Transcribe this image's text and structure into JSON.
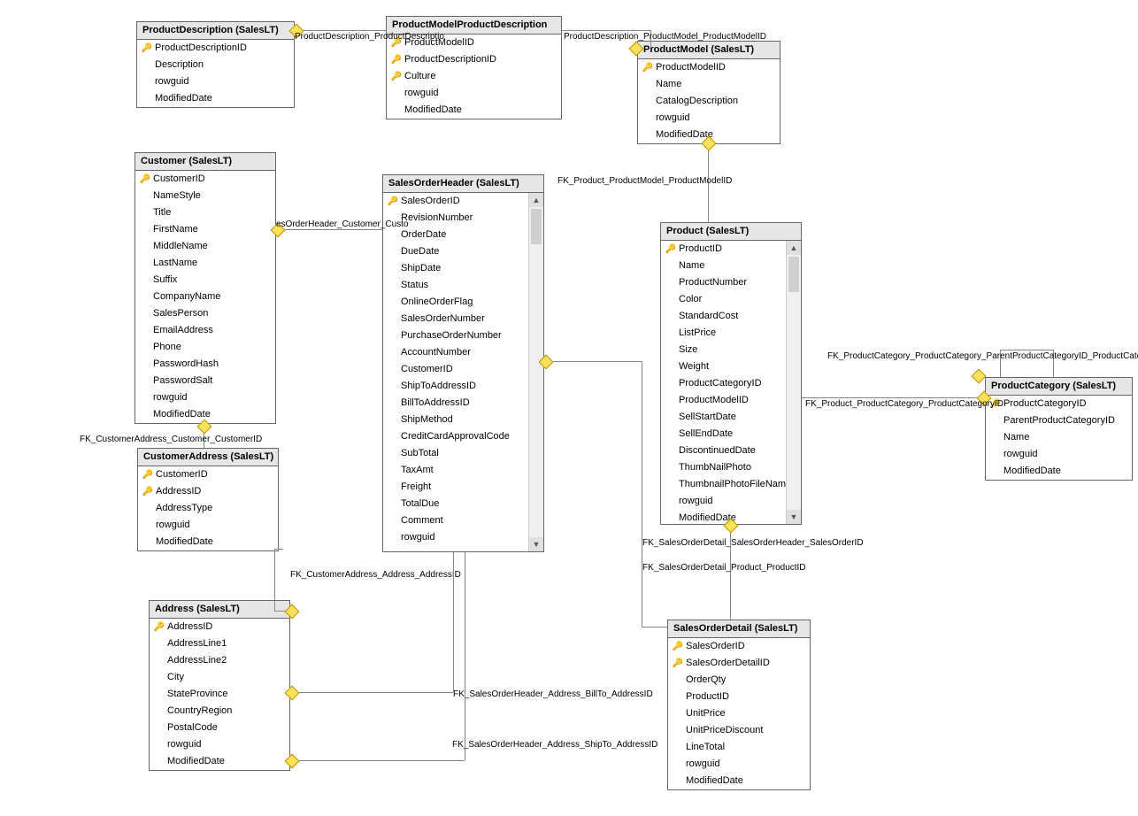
{
  "tables": {
    "productDescription": {
      "title": "ProductDescription (SalesLT)",
      "cols": [
        {
          "k": true,
          "n": "ProductDescriptionID"
        },
        {
          "k": false,
          "n": "Description"
        },
        {
          "k": false,
          "n": "rowguid"
        },
        {
          "k": false,
          "n": "ModifiedDate"
        }
      ]
    },
    "productModelProductDescription": {
      "title": "ProductModelProductDescription",
      "cols": [
        {
          "k": true,
          "n": "ProductModelID"
        },
        {
          "k": true,
          "n": "ProductDescriptionID"
        },
        {
          "k": true,
          "n": "Culture"
        },
        {
          "k": false,
          "n": "rowguid"
        },
        {
          "k": false,
          "n": "ModifiedDate"
        }
      ]
    },
    "productModel": {
      "title": "ProductModel (SalesLT)",
      "cols": [
        {
          "k": true,
          "n": "ProductModelID"
        },
        {
          "k": false,
          "n": "Name"
        },
        {
          "k": false,
          "n": "CatalogDescription"
        },
        {
          "k": false,
          "n": "rowguid"
        },
        {
          "k": false,
          "n": "ModifiedDate"
        }
      ]
    },
    "customer": {
      "title": "Customer (SalesLT)",
      "cols": [
        {
          "k": true,
          "n": "CustomerID"
        },
        {
          "k": false,
          "n": "NameStyle"
        },
        {
          "k": false,
          "n": "Title"
        },
        {
          "k": false,
          "n": "FirstName"
        },
        {
          "k": false,
          "n": "MiddleName"
        },
        {
          "k": false,
          "n": "LastName"
        },
        {
          "k": false,
          "n": "Suffix"
        },
        {
          "k": false,
          "n": "CompanyName"
        },
        {
          "k": false,
          "n": "SalesPerson"
        },
        {
          "k": false,
          "n": "EmailAddress"
        },
        {
          "k": false,
          "n": "Phone"
        },
        {
          "k": false,
          "n": "PasswordHash"
        },
        {
          "k": false,
          "n": "PasswordSalt"
        },
        {
          "k": false,
          "n": "rowguid"
        },
        {
          "k": false,
          "n": "ModifiedDate"
        }
      ]
    },
    "salesOrderHeader": {
      "title": "SalesOrderHeader (SalesLT)",
      "cols": [
        {
          "k": true,
          "n": "SalesOrderID"
        },
        {
          "k": false,
          "n": "RevisionNumber"
        },
        {
          "k": false,
          "n": "OrderDate"
        },
        {
          "k": false,
          "n": "DueDate"
        },
        {
          "k": false,
          "n": "ShipDate"
        },
        {
          "k": false,
          "n": "Status"
        },
        {
          "k": false,
          "n": "OnlineOrderFlag"
        },
        {
          "k": false,
          "n": "SalesOrderNumber"
        },
        {
          "k": false,
          "n": "PurchaseOrderNumber"
        },
        {
          "k": false,
          "n": "AccountNumber"
        },
        {
          "k": false,
          "n": "CustomerID"
        },
        {
          "k": false,
          "n": "ShipToAddressID"
        },
        {
          "k": false,
          "n": "BillToAddressID"
        },
        {
          "k": false,
          "n": "ShipMethod"
        },
        {
          "k": false,
          "n": "CreditCardApprovalCode"
        },
        {
          "k": false,
          "n": "SubTotal"
        },
        {
          "k": false,
          "n": "TaxAmt"
        },
        {
          "k": false,
          "n": "Freight"
        },
        {
          "k": false,
          "n": "TotalDue"
        },
        {
          "k": false,
          "n": "Comment"
        },
        {
          "k": false,
          "n": "rowguid"
        }
      ]
    },
    "product": {
      "title": "Product (SalesLT)",
      "cols": [
        {
          "k": true,
          "n": "ProductID"
        },
        {
          "k": false,
          "n": "Name"
        },
        {
          "k": false,
          "n": "ProductNumber"
        },
        {
          "k": false,
          "n": "Color"
        },
        {
          "k": false,
          "n": "StandardCost"
        },
        {
          "k": false,
          "n": "ListPrice"
        },
        {
          "k": false,
          "n": "Size"
        },
        {
          "k": false,
          "n": "Weight"
        },
        {
          "k": false,
          "n": "ProductCategoryID"
        },
        {
          "k": false,
          "n": "ProductModelID"
        },
        {
          "k": false,
          "n": "SellStartDate"
        },
        {
          "k": false,
          "n": "SellEndDate"
        },
        {
          "k": false,
          "n": "DiscontinuedDate"
        },
        {
          "k": false,
          "n": "ThumbNailPhoto"
        },
        {
          "k": false,
          "n": "ThumbnailPhotoFileName"
        },
        {
          "k": false,
          "n": "rowguid"
        },
        {
          "k": false,
          "n": "ModifiedDate"
        }
      ]
    },
    "productCategory": {
      "title": "ProductCategory (SalesLT)",
      "cols": [
        {
          "k": true,
          "n": "ProductCategoryID"
        },
        {
          "k": false,
          "n": "ParentProductCategoryID"
        },
        {
          "k": false,
          "n": "Name"
        },
        {
          "k": false,
          "n": "rowguid"
        },
        {
          "k": false,
          "n": "ModifiedDate"
        }
      ]
    },
    "customerAddress": {
      "title": "CustomerAddress (SalesLT)",
      "cols": [
        {
          "k": true,
          "n": "CustomerID"
        },
        {
          "k": true,
          "n": "AddressID"
        },
        {
          "k": false,
          "n": "AddressType"
        },
        {
          "k": false,
          "n": "rowguid"
        },
        {
          "k": false,
          "n": "ModifiedDate"
        }
      ]
    },
    "address": {
      "title": "Address (SalesLT)",
      "cols": [
        {
          "k": true,
          "n": "AddressID"
        },
        {
          "k": false,
          "n": "AddressLine1"
        },
        {
          "k": false,
          "n": "AddressLine2"
        },
        {
          "k": false,
          "n": "City"
        },
        {
          "k": false,
          "n": "StateProvince"
        },
        {
          "k": false,
          "n": "CountryRegion"
        },
        {
          "k": false,
          "n": "PostalCode"
        },
        {
          "k": false,
          "n": "rowguid"
        },
        {
          "k": false,
          "n": "ModifiedDate"
        }
      ]
    },
    "salesOrderDetail": {
      "title": "SalesOrderDetail (SalesLT)",
      "cols": [
        {
          "k": true,
          "n": "SalesOrderID"
        },
        {
          "k": true,
          "n": "SalesOrderDetailID"
        },
        {
          "k": false,
          "n": "OrderQty"
        },
        {
          "k": false,
          "n": "ProductID"
        },
        {
          "k": false,
          "n": "UnitPrice"
        },
        {
          "k": false,
          "n": "UnitPriceDiscount"
        },
        {
          "k": false,
          "n": "LineTotal"
        },
        {
          "k": false,
          "n": "rowguid"
        },
        {
          "k": false,
          "n": "ModifiedDate"
        }
      ]
    }
  },
  "labels": {
    "pd_pmpd": "ProductDescription_ProductDescriptio",
    "pmpd_pm": "ProductDescription_ProductModel_ProductModelID",
    "prod_pm": "FK_Product_ProductModel_ProductModelID",
    "prod_pc": "FK_Product_ProductCategory_ProductCategoryID",
    "pc_self": "FK_ProductCategory_ProductCategory_ParentProductCategoryID_ProductCategoryID",
    "soh_cust": "esOrderHeader_Customer_Custo",
    "ca_cust": "FK_CustomerAddress_Customer_CustomerID",
    "ca_addr": "FK_CustomerAddress_Address_AddressID",
    "soh_billto": "FK_SalesOrderHeader_Address_BillTo_AddressID",
    "soh_shipto": "FK_SalesOrderHeader_Address_ShipTo_AddressID",
    "sod_soh": "FK_SalesOrderDetail_SalesOrderHeader_SalesOrderID",
    "sod_prod": "FK_SalesOrderDetail_Product_ProductID"
  }
}
